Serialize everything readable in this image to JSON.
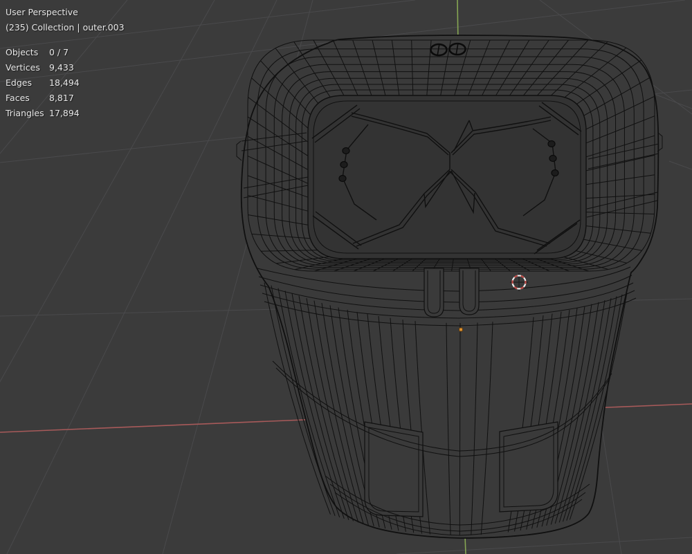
{
  "overlay": {
    "view_name": "User Perspective",
    "context": "(235) Collection | outer.003",
    "stats": [
      {
        "label": "Objects",
        "value": "0 / 7"
      },
      {
        "label": "Vertices",
        "value": "9,433"
      },
      {
        "label": "Edges",
        "value": "18,494"
      },
      {
        "label": "Faces",
        "value": "8,817"
      },
      {
        "label": "Triangles",
        "value": "17,894"
      }
    ]
  },
  "colors": {
    "bg": "#3b3b3b",
    "grid": "#4a4a4c",
    "wire": "#101010",
    "model": "#3a3a3a",
    "face": "#333333",
    "axisx": "#a85a5a",
    "axisy": "#86a653",
    "text": "#e7e7e7",
    "cursorred": "#b94440",
    "cursorwhite": "#ececec",
    "origin": "#e0922f"
  }
}
